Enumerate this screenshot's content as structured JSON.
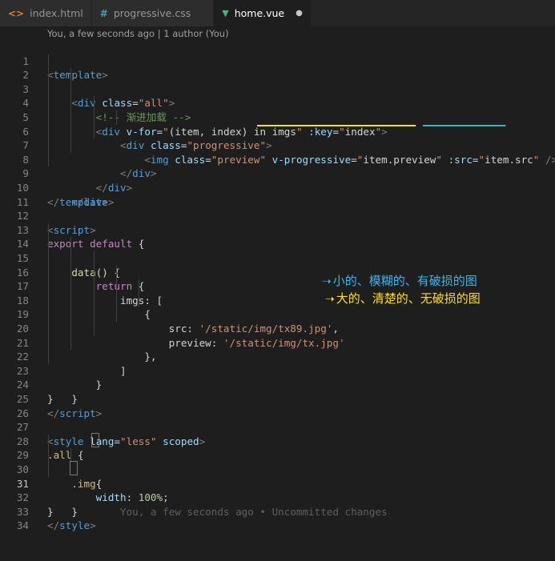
{
  "tabs": [
    {
      "icon": "html-file-icon",
      "label": "index.html",
      "active": false
    },
    {
      "icon": "css-file-icon",
      "label": "progressive.css",
      "active": false
    },
    {
      "icon": "vue-file-icon",
      "label": "home.vue",
      "active": true
    }
  ],
  "blame_top": "You, a few seconds ago | 1 author (You)",
  "annotations": {
    "src_note": "小的、模糊的、有破损的图",
    "preview_note": "大的、清楚的、无破损的图"
  },
  "blame_inline": "You, a few seconds ago • Uncommitted changes",
  "colors": {
    "yellow_underline": "#ffeb00",
    "cyan_underline": "#16c3d6"
  }
}
